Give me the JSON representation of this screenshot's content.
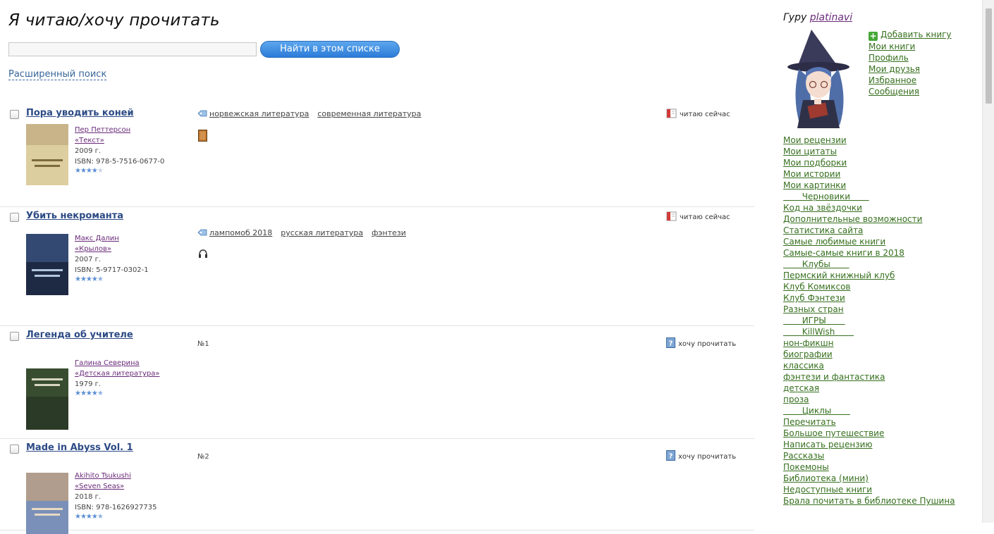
{
  "page": {
    "title": "Я читаю/хочу прочитать"
  },
  "search": {
    "placeholder": "",
    "button_label": "Найти в этом списке",
    "advanced_label": "Расширенный поиск"
  },
  "books": [
    {
      "title": "Пора уводить коней",
      "author": "Пер Петтерсон",
      "publisher": "«Текст»",
      "year": "2009 г.",
      "isbn": "ISBN: 978-5-7516-0677-0",
      "rating": 4,
      "tags": [
        "норвежская литература",
        "современная литература"
      ],
      "number": "",
      "format_icon": "book-icon",
      "status": "читаю сейчас",
      "status_icon": "reading-book-icon"
    },
    {
      "title": "Убить некроманта",
      "author": "Макс Далин",
      "publisher": "«Крылов»",
      "year": "2007 г.",
      "isbn": "ISBN: 5-9717-0302-1",
      "rating": 4.5,
      "tags": [
        "лампомоб 2018",
        "русская литература",
        "фэнтези"
      ],
      "number": "",
      "format_icon": "headphones-icon",
      "status": "читаю сейчас",
      "status_icon": "reading-book-icon"
    },
    {
      "title": "Легенда об учителе",
      "author": "Галина Северина",
      "publisher": "«Детская литература»",
      "year": "1979 г.",
      "isbn": "",
      "rating": 4.5,
      "tags": [],
      "number": "№1",
      "format_icon": "",
      "status": "хочу прочитать",
      "status_icon": "question-book-icon"
    },
    {
      "title": "Made in Abyss Vol. 1",
      "author": "Akihito Tsukushi",
      "publisher": "«Seven Seas»",
      "year": "2018 г.",
      "isbn": "ISBN: 978-1626927735",
      "rating": 4.5,
      "tags": [],
      "number": "№2",
      "format_icon": "",
      "status": "хочу прочитать",
      "status_icon": "question-book-icon"
    }
  ],
  "sidebar": {
    "guru_label": "Гуру",
    "username": "platinavi",
    "profile_links": [
      "Добавить книгу",
      "Мои книги",
      "Профиль",
      "Мои друзья",
      "Избранное",
      "Сообщения"
    ],
    "nav_links": [
      "Мои рецензии",
      "Мои цитаты",
      "Мои подборки",
      "Мои истории",
      "Мои картинки",
      "       Черновики       ",
      "Код на звёздочки",
      "Дополнительные возможности",
      "Статистика сайта",
      "Самые любимые книги",
      "Самые-самые книги в 2018",
      "       Клубы       ",
      "Пермский книжный клуб",
      "Клуб Комиксов",
      "Клуб Фэнтези",
      "Разных стран",
      "       ИГРЫ       ",
      "       KillWish       ",
      "нон-фикшн",
      "биографии",
      "классика",
      "фэнтези и фантастика",
      "детская",
      "проза",
      "       Циклы       ",
      "Перечитать",
      "Большое путешествие",
      "Написать рецензию",
      "Рассказы",
      "Покемоны",
      "Библиотека (мини)",
      "Недоступные книги",
      "Брала почитать в библиотеке Пушина"
    ]
  }
}
